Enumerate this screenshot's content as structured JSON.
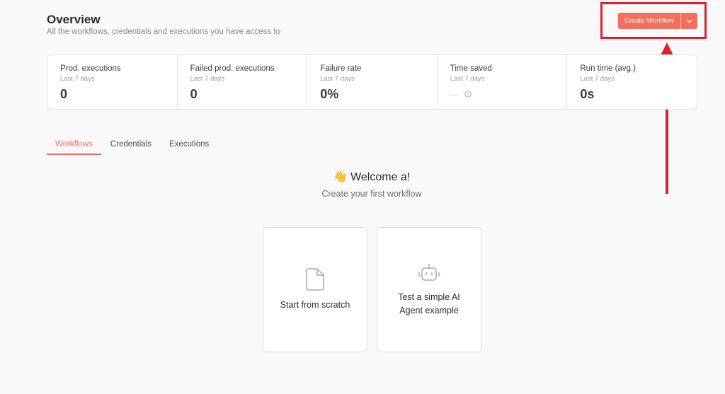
{
  "header": {
    "title": "Overview",
    "subtitle": "All the workflows, credentials and executions you have access to"
  },
  "create_workflow": {
    "label": "Create Workflow",
    "accent_color": "#f46e5d"
  },
  "annotation": {
    "highlight_color": "#e0212a"
  },
  "stats": [
    {
      "label": "Prod. executions",
      "period": "Last 7 days",
      "value": "0"
    },
    {
      "label": "Failed prod. executions",
      "period": "Last 7 days",
      "value": "0"
    },
    {
      "label": "Failure rate",
      "period": "Last 7 days",
      "value": "0%"
    },
    {
      "label": "Time saved",
      "period": "Last 7 days",
      "value": "--",
      "icon": "info-icon"
    },
    {
      "label": "Run time (avg.)",
      "period": "Last 7 days",
      "value": "0s"
    }
  ],
  "tabs": [
    {
      "label": "Workflows",
      "active": true
    },
    {
      "label": "Credentials",
      "active": false
    },
    {
      "label": "Executions",
      "active": false
    }
  ],
  "welcome": {
    "emoji": "👋",
    "title": "Welcome a!",
    "subtitle": "Create your first workflow"
  },
  "cards": [
    {
      "label": "Start from scratch",
      "icon": "file-icon"
    },
    {
      "label": "Test a simple AI Agent example",
      "icon": "robot-icon"
    }
  ]
}
